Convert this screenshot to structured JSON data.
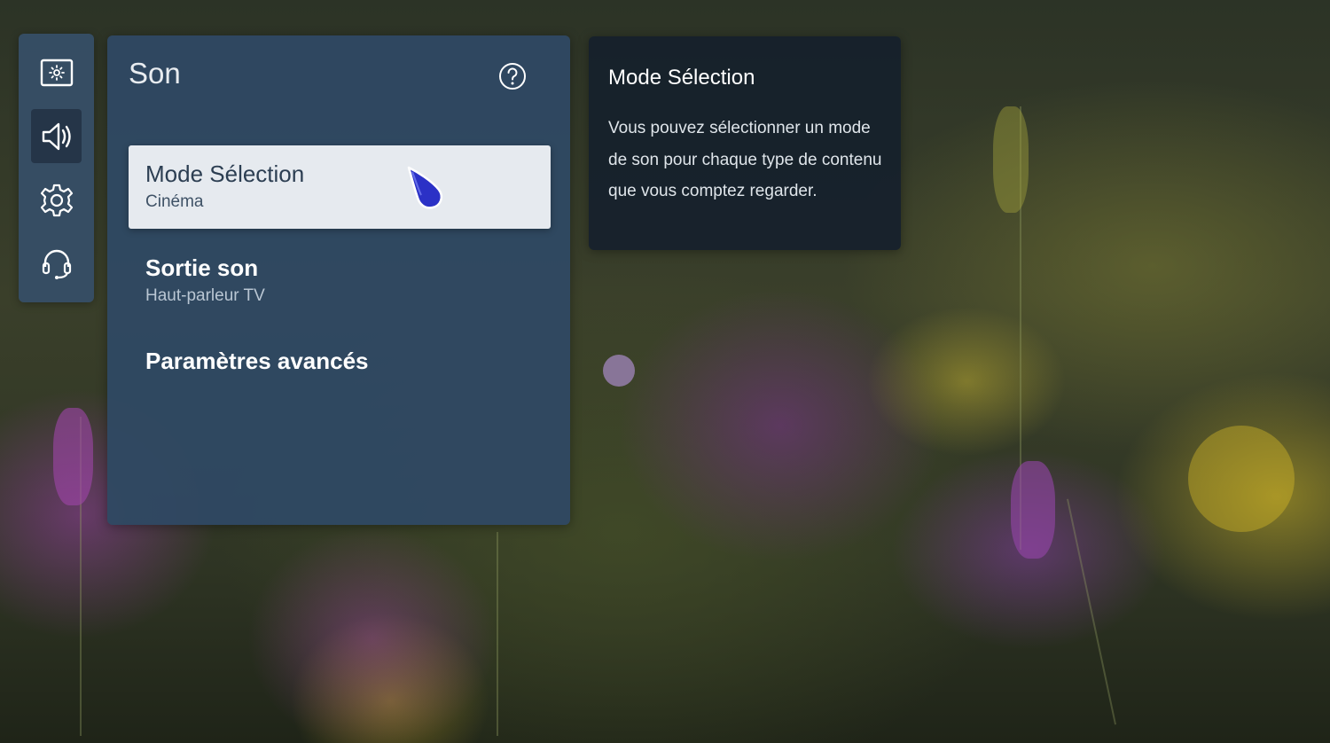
{
  "rail": {
    "items": [
      {
        "icon": "picture-icon",
        "active": false
      },
      {
        "icon": "speaker-icon",
        "active": true
      },
      {
        "icon": "gear-icon",
        "active": false
      },
      {
        "icon": "headset-icon",
        "active": false
      }
    ]
  },
  "panel": {
    "title": "Son",
    "help_icon": "question-circle-icon",
    "items": [
      {
        "label": "Mode Sélection",
        "value": "Cinéma",
        "selected": true
      },
      {
        "label": "Sortie son",
        "value": "Haut-parleur TV",
        "selected": false
      },
      {
        "label": "Paramètres avancés",
        "value": "",
        "selected": false
      }
    ]
  },
  "info": {
    "title": "Mode Sélection",
    "text": "Vous pouvez sélectionner un mode de son pour chaque type de contenu que vous comptez regarder."
  },
  "colors": {
    "panel_bg": "#30486a",
    "rail_bg": "#364e66",
    "selected_bg": "#e6eaef",
    "pointer": "#2a2fc8"
  }
}
